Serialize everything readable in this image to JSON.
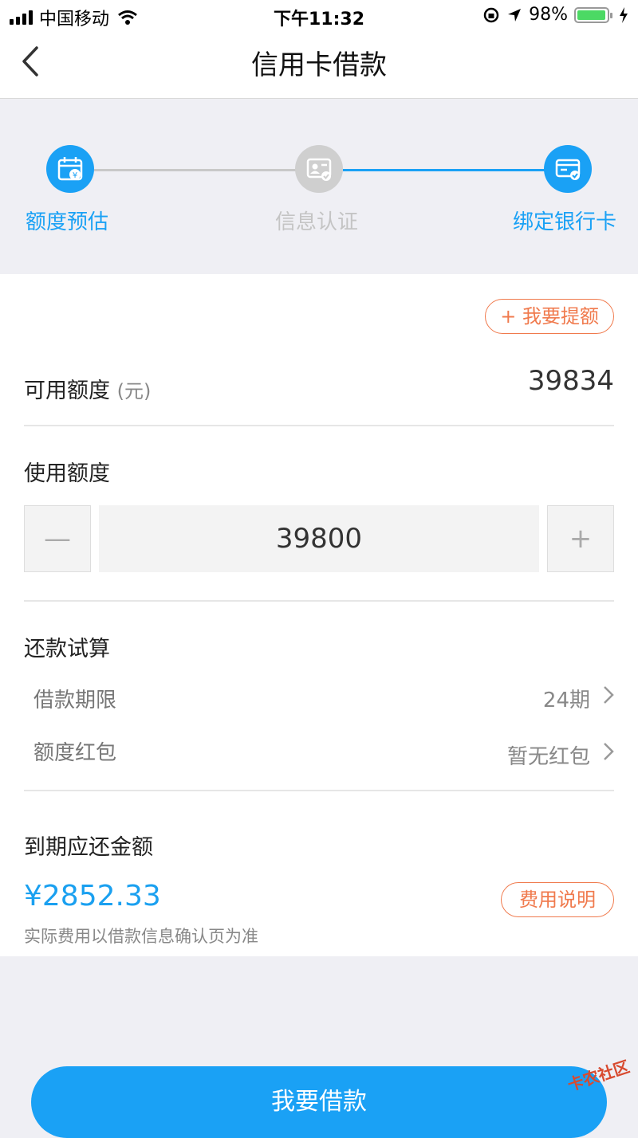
{
  "status_bar": {
    "carrier": "中国移动",
    "time": "下午11:32",
    "battery": "98%"
  },
  "header": {
    "title": "信用卡借款"
  },
  "steps": [
    {
      "label": "额度预估",
      "state": "done"
    },
    {
      "label": "信息认证",
      "state": "inactive"
    },
    {
      "label": "绑定银行卡",
      "state": "active"
    }
  ],
  "raise_limit_label": "+ 我要提额",
  "available": {
    "label": "可用额度",
    "unit": "(元)",
    "value": "39834"
  },
  "use_amount": {
    "label": "使用额度",
    "value": "39800",
    "minus": "—",
    "plus": "+"
  },
  "repay": {
    "title": "还款试算",
    "term_label": "借款期限",
    "term_value": "24期",
    "packet_label": "额度红包",
    "packet_value": "暂无红包"
  },
  "due": {
    "title": "到期应还金额",
    "amount": "¥2852.33",
    "fee_button": "费用说明",
    "note": "实际费用以借款信息确认页为准"
  },
  "submit_label": "我要借款",
  "watermark": "卡农社区",
  "colors": {
    "primary": "#1aa1f5",
    "accent": "#f07a4d"
  }
}
